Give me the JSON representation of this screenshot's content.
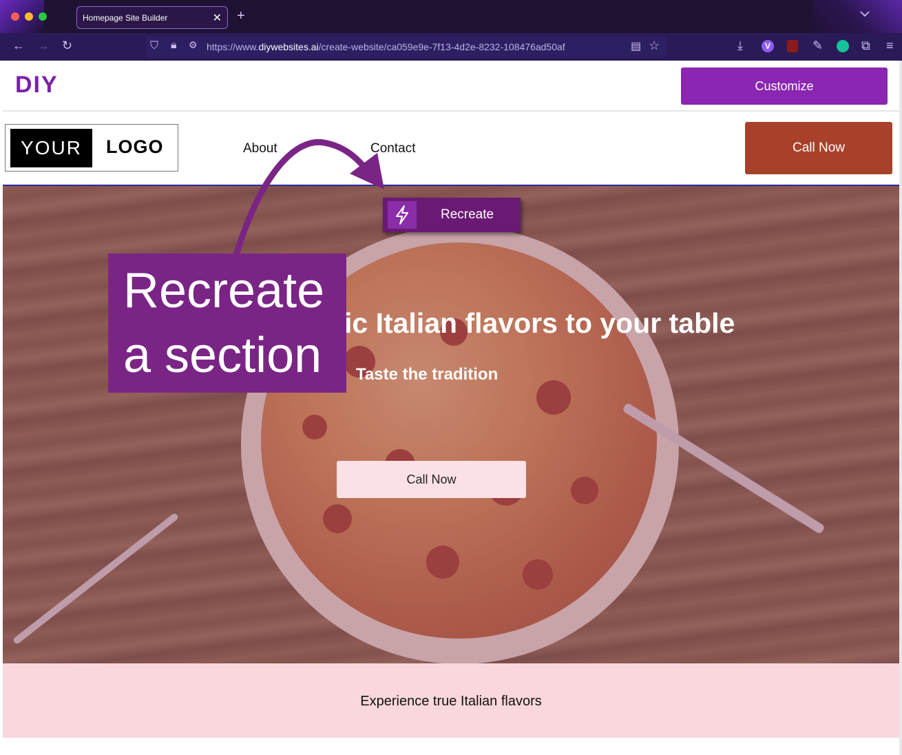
{
  "browser": {
    "tab_title": "Homepage Site Builder",
    "tab_close": "✕",
    "new_tab": "+",
    "tab_menu": "⌄",
    "url_prefix": "https://www.",
    "url_domain": "diywebsites.ai",
    "url_path": "/create-website/ca059e9e-7f13-4d2e-8232-108476ad50af",
    "traffic_lights": [
      "#ff5f57",
      "#febc2e",
      "#28c840"
    ]
  },
  "builder": {
    "brand": "DIY",
    "customize_label": "Customize"
  },
  "site": {
    "logo_left": "YOUR",
    "logo_right": "LOGO",
    "nav": [
      "About",
      "Contact"
    ],
    "call_now_top": "Call Now",
    "hero": {
      "headline": "ic Italian flavors to your table",
      "tagline": "Taste the tradition",
      "call_now": "Call Now"
    },
    "band_text": "Experience true Italian flavors"
  },
  "overlay": {
    "recreate_button": "Recreate",
    "callout_line1": "Recreate",
    "callout_line2": "a section"
  },
  "colors": {
    "brand_purple": "#8a26b1",
    "call_now_red": "#a8412a",
    "callout_purple": "#7a2585",
    "band_pink": "#f9d7dc"
  }
}
